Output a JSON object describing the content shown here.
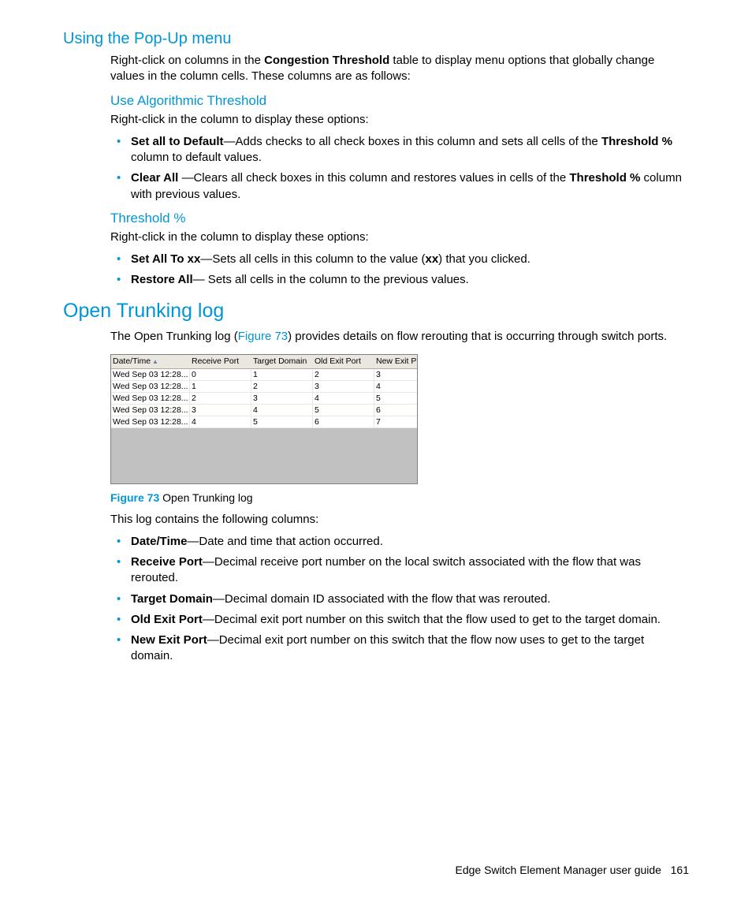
{
  "section1": {
    "title": "Using the Pop-Up menu",
    "intro_pre": "Right-click on columns in the ",
    "intro_bold": "Congestion Threshold",
    "intro_post": " table to display menu options that globally change values in the column cells. These columns are as follows:",
    "sub1": {
      "title": "Use Algorithmic Threshold",
      "intro": "Right-click in the column to display these options:",
      "items": [
        {
          "b": "Set all to Default",
          "t1": "—Adds checks to all check boxes in this column and sets all cells of the ",
          "b2": "Threshold %",
          "t2": " column to default values."
        },
        {
          "b": "Clear All ",
          "t1": "—Clears all check boxes in this column and restores values in cells of the ",
          "b2": "Threshold %",
          "t2": " column with previous values."
        }
      ]
    },
    "sub2": {
      "title": "Threshold %",
      "intro": "Right-click in the column to display these options:",
      "items": [
        {
          "b": "Set All To xx",
          "t1": "—Sets all cells in this column to the value (",
          "b2": "xx",
          "t2": ") that you clicked."
        },
        {
          "b": "Restore All",
          "t1": "— Sets all cells in the column to the previous values.",
          "b2": "",
          "t2": ""
        }
      ]
    }
  },
  "section2": {
    "title": "Open Trunking log",
    "intro_pre": "The Open Trunking log (",
    "intro_link": "Figure 73",
    "intro_post": ") provides details on flow rerouting that is occurring through switch ports.",
    "figure": {
      "headers": [
        "Date/Time",
        "Receive Port",
        "Target Domain",
        "Old Exit Port",
        "New Exit P"
      ],
      "rows": [
        [
          "Wed Sep 03 12:28...",
          "0",
          "1",
          "2",
          "3"
        ],
        [
          "Wed Sep 03 12:28...",
          "1",
          "2",
          "3",
          "4"
        ],
        [
          "Wed Sep 03 12:28...",
          "2",
          "3",
          "4",
          "5"
        ],
        [
          "Wed Sep 03 12:28...",
          "3",
          "4",
          "5",
          "6"
        ],
        [
          "Wed Sep 03 12:28...",
          "4",
          "5",
          "6",
          "7"
        ]
      ],
      "caption_label": "Figure 73",
      "caption_text": "  Open Trunking log"
    },
    "cols_intro": "This log contains the following columns:",
    "cols": [
      {
        "b": "Date/Time",
        "t": "—Date and time that action occurred."
      },
      {
        "b": "Receive Port",
        "t": "—Decimal receive port number on the local switch associated with the flow that was rerouted."
      },
      {
        "b": "Target Domain",
        "t": "—Decimal domain ID associated with the flow that was rerouted."
      },
      {
        "b": "Old Exit Port",
        "t": "—Decimal exit port number on this switch that the flow used to get to the target domain."
      },
      {
        "b": "New Exit Port",
        "t": "—Decimal exit port number on this switch that the flow now uses to get to the target domain."
      }
    ]
  },
  "footer": {
    "text": "Edge Switch Element Manager user guide",
    "page": "161"
  }
}
